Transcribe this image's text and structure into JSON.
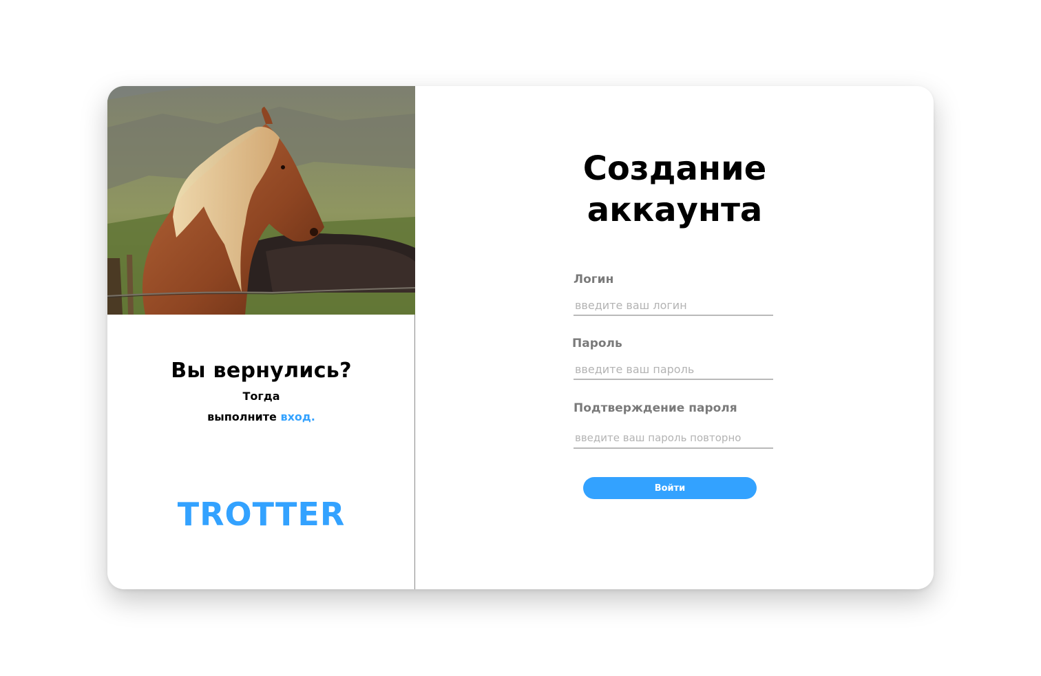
{
  "left_panel": {
    "image": "horse-photo",
    "return_title": "Вы вернулись?",
    "return_line1": "Тогда",
    "return_line2_prefix": "выполните ",
    "login_link": "вход.",
    "logo": "TROTTER"
  },
  "form": {
    "title_line1": "Создание",
    "title_line2": "аккаунта",
    "fields": [
      {
        "label": "Логин",
        "placeholder": "введите ваш логин",
        "value": ""
      },
      {
        "label": "Пароль",
        "placeholder": "введите ваш пароль",
        "value": ""
      },
      {
        "label": "Подтверждение пароля",
        "placeholder": "введите ваш пароль повторно",
        "value": ""
      }
    ],
    "submit_label": "Войти"
  },
  "colors": {
    "accent": "#33a2ff",
    "label_gray": "#7a7a7a",
    "placeholder_gray": "#b3b3b3"
  }
}
